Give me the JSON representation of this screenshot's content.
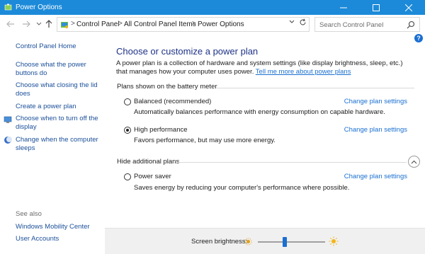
{
  "window": {
    "title": "Power Options"
  },
  "address": {
    "crumbs": [
      "Control Panel",
      "All Control Panel Items",
      "Power Options"
    ]
  },
  "search": {
    "placeholder": "Search Control Panel"
  },
  "help_label": "?",
  "sidebar": {
    "home": "Control Panel Home",
    "items": [
      {
        "label": "Choose what the power buttons do",
        "icon": ""
      },
      {
        "label": "Choose what closing the lid does",
        "icon": ""
      },
      {
        "label": "Create a power plan",
        "icon": ""
      },
      {
        "label": "Choose when to turn off the display",
        "icon": "display-shield-icon"
      },
      {
        "label": "Change when the computer sleeps",
        "icon": "moon-icon"
      }
    ],
    "see_also": "See also",
    "see_also_items": [
      "Windows Mobility Center",
      "User Accounts"
    ]
  },
  "main": {
    "heading": "Choose or customize a power plan",
    "intro": "A power plan is a collection of hardware and system settings (like display brightness, sleep, etc.) that manages how your computer uses power.",
    "intro_link": "Tell me more about power plans",
    "group_battery": "Plans shown on the battery meter",
    "group_hidden": "Hide additional plans",
    "change_label": "Change plan settings",
    "plans": [
      {
        "name": "Balanced (recommended)",
        "desc": "Automatically balances performance with energy consumption on capable hardware.",
        "selected": false
      },
      {
        "name": "High performance",
        "desc": "Favors performance, but may use more energy.",
        "selected": true
      },
      {
        "name": "Power saver",
        "desc": "Saves energy by reducing your computer's performance where possible.",
        "selected": false
      }
    ]
  },
  "brightness": {
    "label": "Screen brightness:",
    "level": 0.4
  },
  "colors": {
    "titlebar": "#1c8ad9",
    "link": "#1a6fd1",
    "heading": "#1e3287"
  }
}
